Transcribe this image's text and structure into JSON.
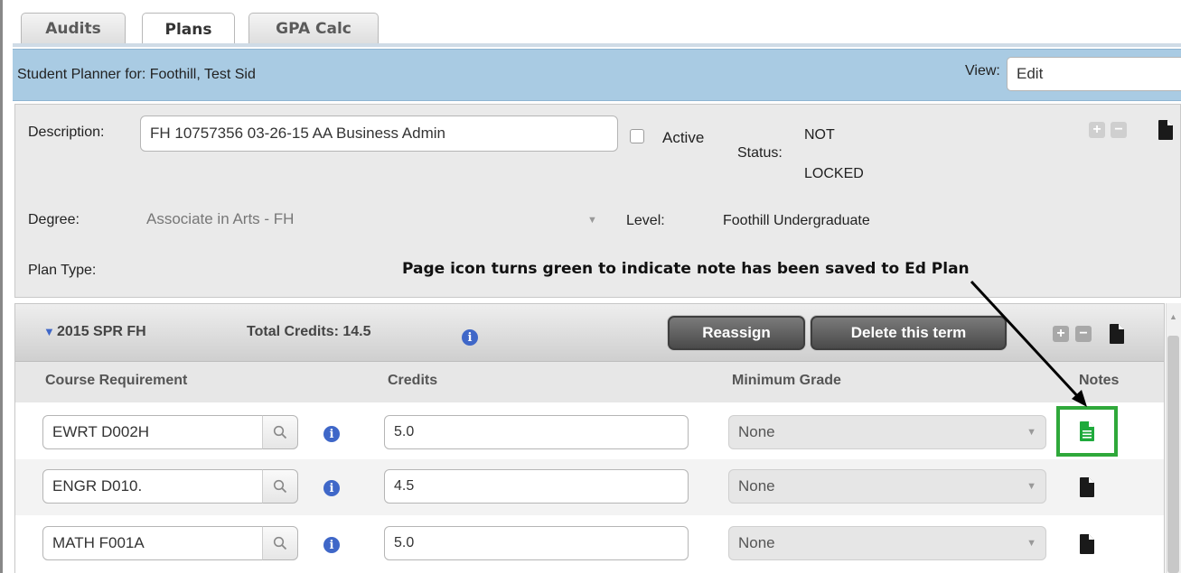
{
  "tabs": [
    {
      "label": "Audits"
    },
    {
      "label": "Plans"
    },
    {
      "label": "GPA Calc"
    }
  ],
  "header": {
    "title": "Student Planner for: Foothill, Test Sid",
    "view_label": "View:",
    "view_value": "Edit"
  },
  "plan": {
    "description_label": "Description:",
    "description_value": "FH 10757356 03-26-15 AA Business Admin",
    "active_label": "Active",
    "status_label": "Status:",
    "status_value_line1": "NOT",
    "status_value_line2": "LOCKED",
    "degree_label": "Degree:",
    "degree_value": "Associate in Arts - FH",
    "level_label": "Level:",
    "level_value": "Foothill Undergraduate",
    "plan_type_label": "Plan Type:",
    "annotation": "Page icon turns green to indicate note has been saved to Ed Plan"
  },
  "term": {
    "name": "2015 SPR FH",
    "total_credits": "Total Credits: 14.5",
    "reassign_label": "Reassign",
    "delete_label": "Delete this term",
    "columns": {
      "course": "Course Requirement",
      "credits": "Credits",
      "grade": "Minimum Grade",
      "notes": "Notes"
    },
    "rows": [
      {
        "course": "EWRT D002H",
        "credits": "5.0",
        "grade": "None",
        "note_saved": true
      },
      {
        "course": "ENGR D010.",
        "credits": "4.5",
        "grade": "None",
        "note_saved": false
      },
      {
        "course": "MATH F001A",
        "credits": "5.0",
        "grade": "None",
        "note_saved": false
      }
    ]
  },
  "colors": {
    "header_bg": "#a9cbe3",
    "note_saved_green": "#1faa3c",
    "highlight_box": "#2fa83a",
    "info_blue": "#3f67c8"
  }
}
